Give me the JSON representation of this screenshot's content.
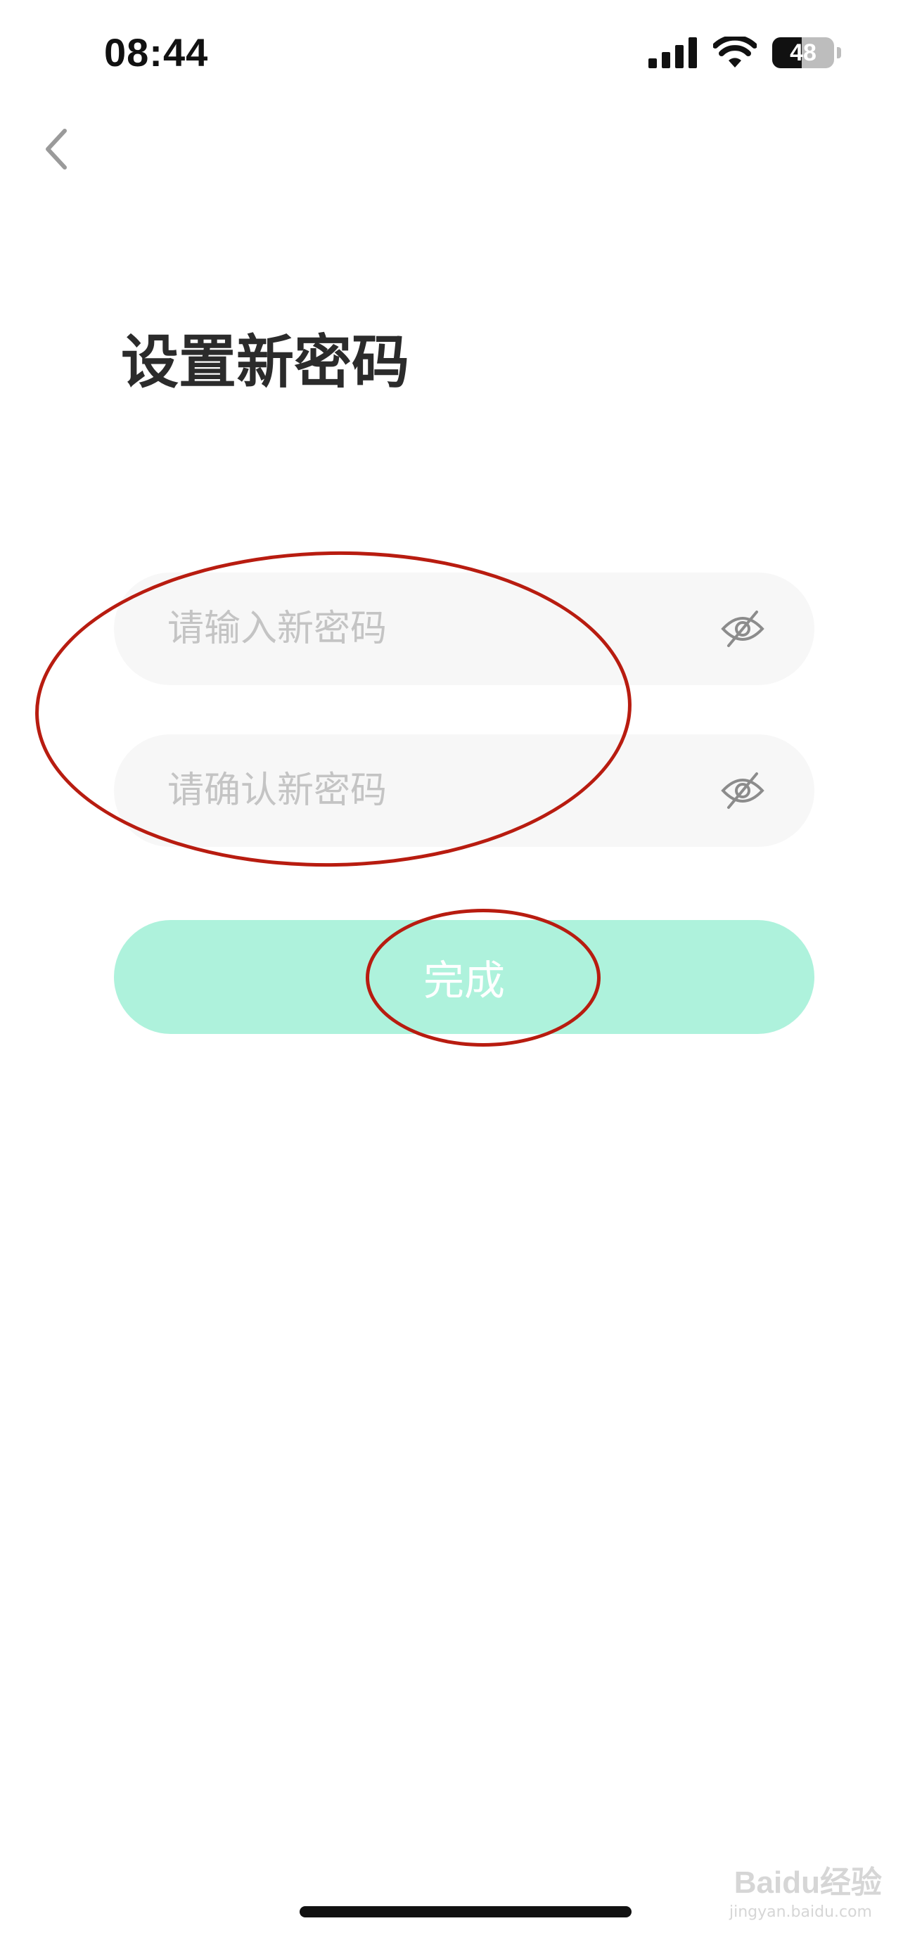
{
  "status_bar": {
    "time": "08:44",
    "battery_level": "48",
    "icons": [
      "signal-icon",
      "wifi-icon",
      "battery-icon"
    ]
  },
  "nav": {
    "back_icon": "chevron-left-icon"
  },
  "page": {
    "title": "设置新密码"
  },
  "form": {
    "new_password": {
      "value": "",
      "placeholder": "请输入新密码",
      "toggle_icon": "eye-hidden-icon"
    },
    "confirm_password": {
      "value": "",
      "placeholder": "请确认新密码",
      "toggle_icon": "eye-hidden-icon"
    },
    "submit_label": "完成"
  },
  "watermark": {
    "brand": "Baidu经验",
    "url": "jingyan.baidu.com"
  },
  "colors": {
    "button_bg": "#aef2dc",
    "field_bg": "#f7f7f7",
    "annotation": "#b81c10"
  }
}
